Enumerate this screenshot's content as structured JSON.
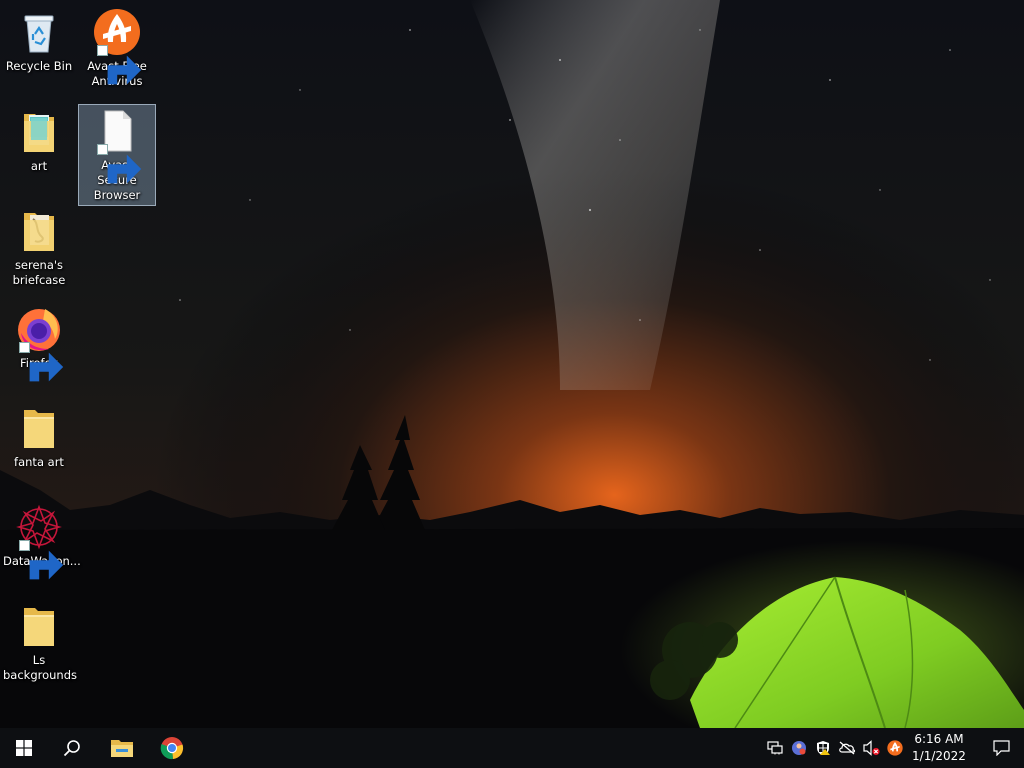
{
  "desktop": {
    "icons": [
      {
        "label": "Recycle Bin",
        "icon": "recycle-bin-icon"
      },
      {
        "label": "Avast Free Antivirus",
        "icon": "avast-icon"
      },
      {
        "label": "art",
        "icon": "folder-icon"
      },
      {
        "label": "Avast Secure Browser",
        "icon": "blank-file-icon"
      },
      {
        "label": "serena's briefcase",
        "icon": "folder-icon"
      },
      {
        "label": "Firefox",
        "icon": "firefox-icon"
      },
      {
        "label": "fanta art",
        "icon": "folder-icon"
      },
      {
        "label": "DataWagon...",
        "icon": "datawagon-icon"
      },
      {
        "label": "Ls backgrounds",
        "icon": "folder-icon"
      }
    ]
  },
  "taskbar": {
    "pinned": [
      "start-icon",
      "search-icon",
      "file-explorer-icon",
      "chrome-icon"
    ],
    "tray": [
      "network-icon",
      "people-icon",
      "security-shield-icon",
      "onedrive-offline-icon",
      "speaker-muted-icon",
      "avast-tray-icon"
    ],
    "time": "6:16 AM",
    "date": "1/1/2022"
  },
  "colors": {
    "taskbar_bg": "#0d0f12",
    "avast_orange": "#f36d1e",
    "tent_green": "#8fd62a",
    "horizon_orange": "#d9621d",
    "folder_yellow": "#f5d77a"
  }
}
